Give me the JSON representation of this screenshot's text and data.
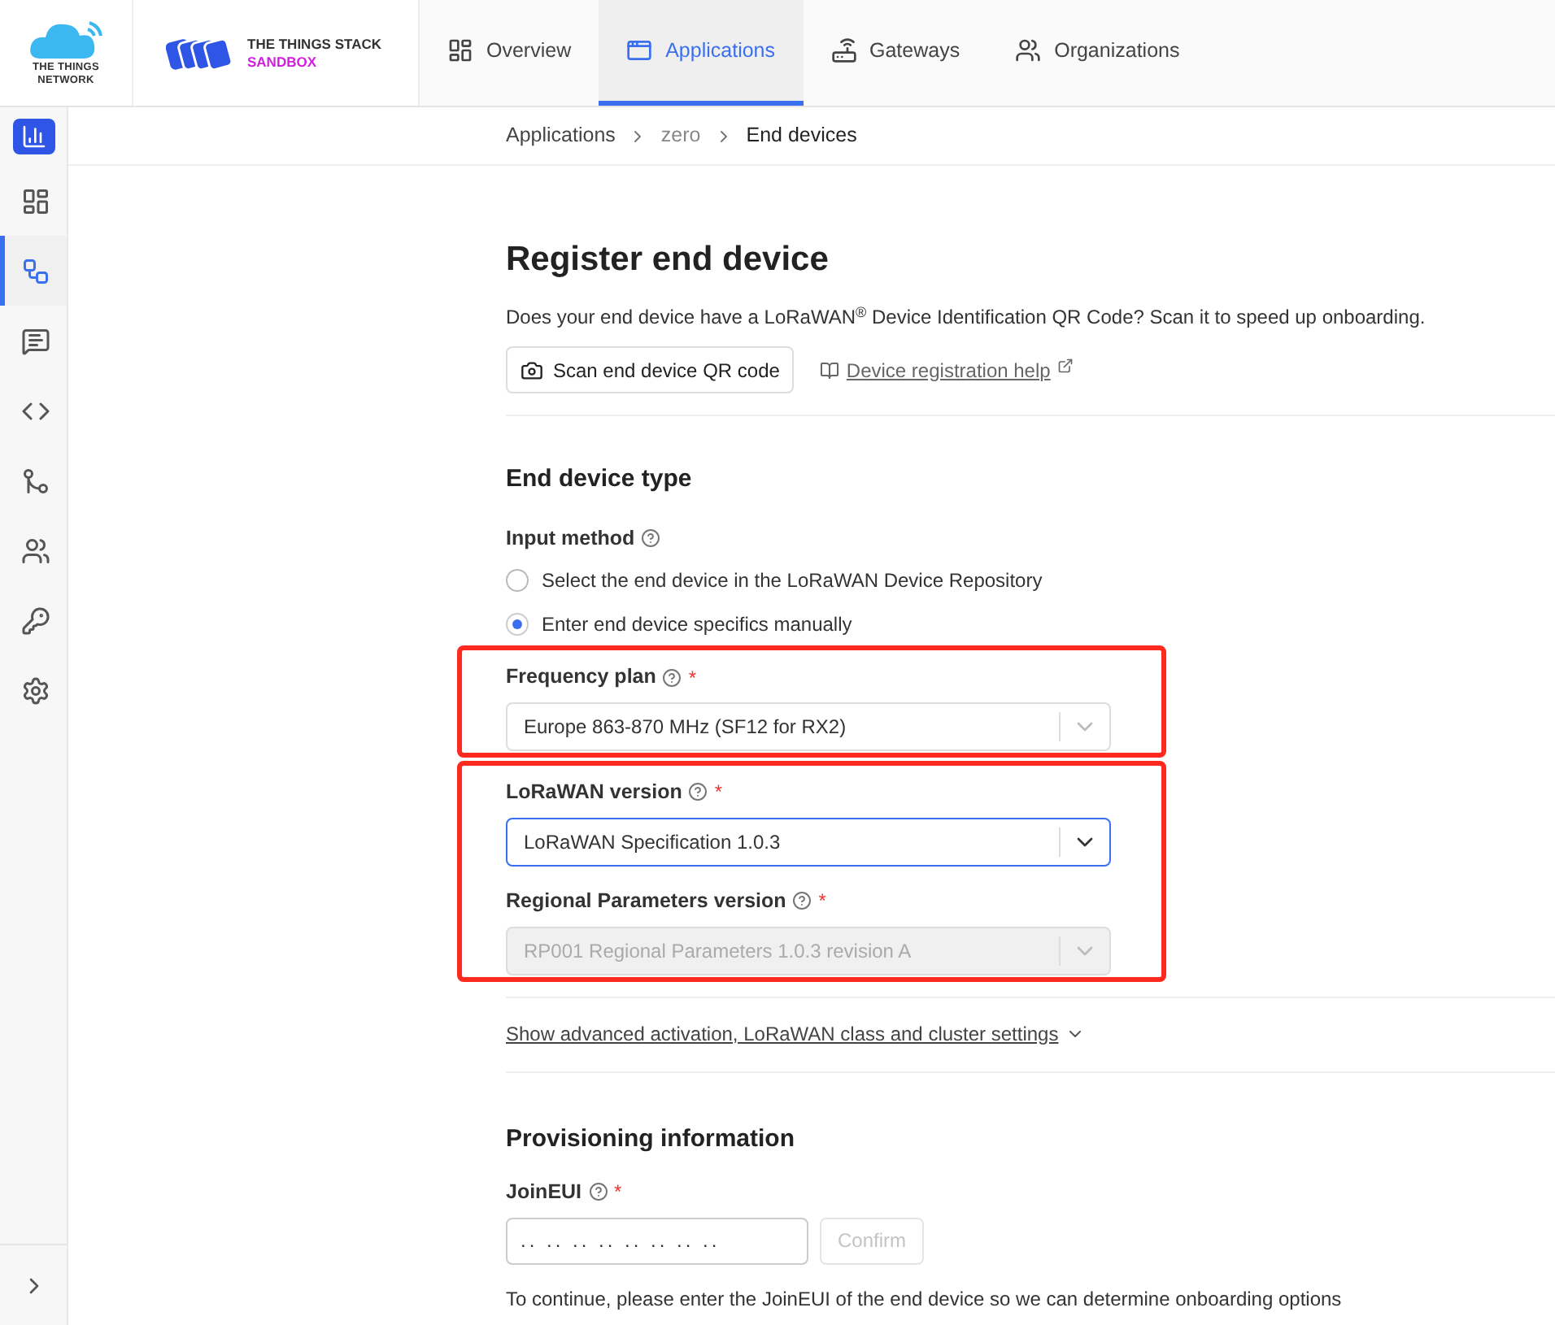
{
  "header": {
    "network_logo": {
      "line_1": "THE THINGS",
      "line_2": "NETWORK"
    },
    "stack_logo": {
      "line_1": "THE THINGS STACK",
      "line_2": "SANDBOX"
    },
    "nav": [
      {
        "label": "Overview",
        "kind": "overview",
        "selected": false
      },
      {
        "label": "Applications",
        "kind": "applications",
        "selected": true
      },
      {
        "label": "Gateways",
        "kind": "gateways",
        "selected": false
      },
      {
        "label": "Organizations",
        "kind": "organizations",
        "selected": false
      }
    ]
  },
  "sidebar": {
    "items": [
      {
        "kind": "dashboard",
        "selected": false
      },
      {
        "kind": "devices",
        "selected": true
      },
      {
        "kind": "messages",
        "selected": false
      },
      {
        "kind": "code",
        "selected": false
      },
      {
        "kind": "merge",
        "selected": false
      },
      {
        "kind": "people",
        "selected": false
      },
      {
        "kind": "key",
        "selected": false
      },
      {
        "kind": "settings",
        "selected": false
      }
    ]
  },
  "breadcrumb": [
    {
      "label": "Applications",
      "current": false
    },
    {
      "label": "zero",
      "current": false
    },
    {
      "label": "End devices",
      "current": true
    }
  ],
  "page": {
    "title": "Register end device",
    "intro": "Does your end device have a LoRaWAN$^{®}$ Device Identification QR Code? Scan it to speed up onboarding.",
    "scan_button": "Scan end device QR code",
    "help_link": "Device registration help"
  },
  "end_device_type": {
    "heading": "End device type",
    "input_method": {
      "label": "Input method",
      "options": [
        {
          "label": "Select the end device in the LoRaWAN Device Repository",
          "selected": false
        },
        {
          "label": "Enter end device specifics manually",
          "selected": true
        }
      ]
    },
    "groups": [
      {
        "highlighted": true,
        "fields": [
          {
            "label": "Frequency plan",
            "required_mark": "*",
            "value": "Europe 863-870 MHz (SF12 for RX2)",
            "focused": false,
            "disabled": false
          }
        ]
      },
      {
        "highlighted": true,
        "fields": [
          {
            "label": "LoRaWAN version",
            "required_mark": "*",
            "value": "LoRaWAN Specification 1.0.3",
            "focused": true,
            "disabled": false
          },
          {
            "label": "Regional Parameters version",
            "required_mark": "*",
            "value": "RP001 Regional Parameters 1.0.3 revision A",
            "focused": false,
            "disabled": true
          }
        ]
      }
    ],
    "advanced_link": "Show advanced activation, LoRaWAN class and cluster settings"
  },
  "provisioning": {
    "heading": "Provisioning information",
    "join_eui": {
      "label": "JoinEUI",
      "required_mark": "*",
      "placeholder": ".. .. .. .. .. .. .. .."
    },
    "confirm_button": {
      "label": "Confirm",
      "disabled": true
    },
    "hint": "To continue, please enter the JoinEUI of the end device so we can determine onboarding options"
  }
}
